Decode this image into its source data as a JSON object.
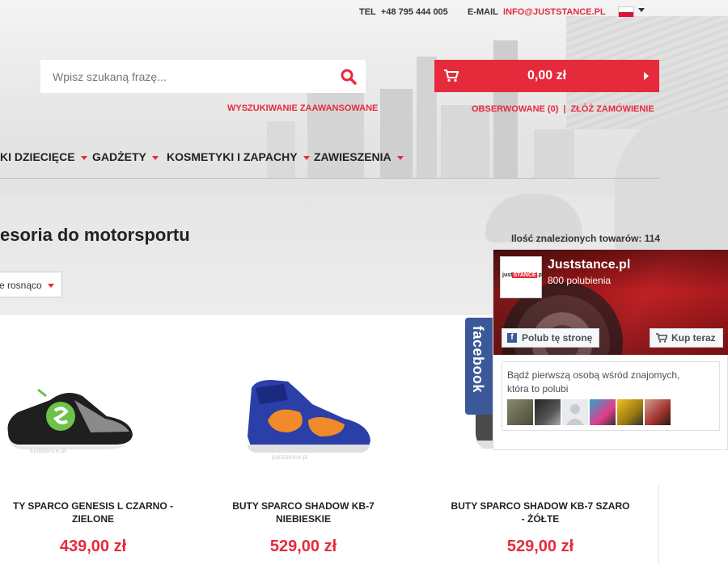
{
  "topbar": {
    "tel_label": "TEL",
    "tel_value": "+48 795 444 005",
    "email_label": "E-MAIL",
    "email_value": "INFO@JUSTSTANCE.PL",
    "language_flag": "pl-flag-icon"
  },
  "search": {
    "placeholder": "Wpisz szukaną frazę...",
    "advanced_link": "WYSZUKIWANIE ZAAWANSOWANE"
  },
  "cart": {
    "value": "0,00 zł"
  },
  "user_links": {
    "watched": "OBSERWOWANE (0)",
    "separator": "|",
    "order": "ZŁÓŻ ZAMÓWIENIE"
  },
  "nav": {
    "items": [
      {
        "label": "KI DZIECIĘCE"
      },
      {
        "label": "GADŻETY"
      },
      {
        "label": "KOSMETYKI I ZAPACHY"
      },
      {
        "label": "ZAWIESZENIA"
      }
    ]
  },
  "category": {
    "title": "esoria do motorsportu",
    "count_text": "Ilość znalezionych towarów: 114",
    "sort_label": "e rosnąco"
  },
  "products": [
    {
      "name_line1": "TY SPARCO GENESIS L CZARNO -",
      "name_line2": "ZIELONE",
      "price": "439,00 zł"
    },
    {
      "name_line1": "BUTY SPARCO SHADOW KB-7",
      "name_line2": "NIEBIESKIE",
      "price": "529,00 zł"
    },
    {
      "name_line1": "BUTY SPARCO SHADOW KB-7 SZARO",
      "name_line2": "- ŻÓŁTE",
      "price": "529,00 zł"
    }
  ],
  "facebook": {
    "tab_label": "facebook",
    "page_name": "Juststance.pl",
    "likes": "800 polubienia",
    "like_button": "Polub tę stronę",
    "buy_button": "Kup teraz",
    "friends_line1": "Bądź pierwszą osobą wśród znajomych,",
    "friends_line2": "która to polubi",
    "logo_text_a": "just",
    "logo_text_b": "STANCE",
    "logo_text_c": ".pl"
  },
  "colors": {
    "accent": "#e52b3b",
    "facebook": "#3b5998"
  }
}
